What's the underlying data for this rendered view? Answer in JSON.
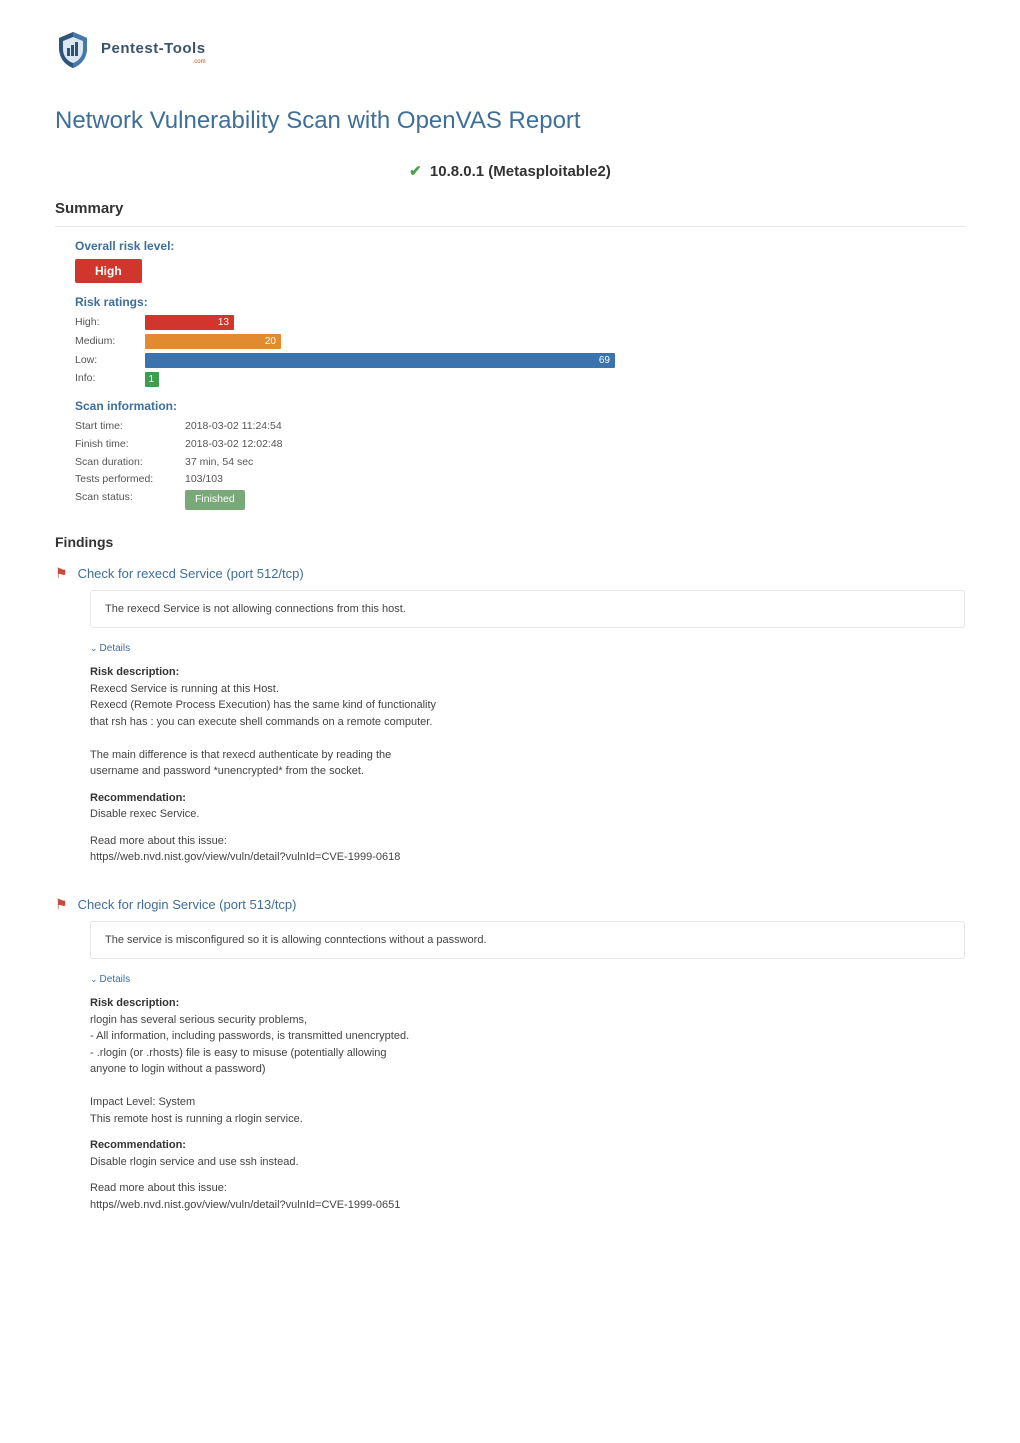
{
  "header": {
    "logo_text": "Pentest-Tools",
    "logo_sub": ".com"
  },
  "page_title": "Network Vulnerability Scan with OpenVAS Report",
  "target": {
    "ip": "10.8.0.1",
    "name": "(Metasploitable2)"
  },
  "summary": {
    "heading": "Summary",
    "overall_label": "Overall risk level:",
    "overall_value": "High",
    "ratings_label": "Risk ratings:",
    "ratings": [
      {
        "label": "High:",
        "value": 13,
        "color": "#d0362c",
        "max": 69
      },
      {
        "label": "Medium:",
        "value": 20,
        "color": "#e28a2f",
        "max": 69
      },
      {
        "label": "Low:",
        "value": 69,
        "color": "#3b73af",
        "max": 69
      },
      {
        "label": "Info:",
        "value": 1,
        "color": "#3f9e4c",
        "max": 69
      }
    ],
    "scan_info_label": "Scan information:",
    "scan_info": {
      "start_time_label": "Start time:",
      "start_time": "2018-03-02 11:24:54",
      "finish_time_label": "Finish time:",
      "finish_time": "2018-03-02 12:02:48",
      "duration_label": "Scan duration:",
      "duration": "37 min, 54 sec",
      "tests_label": "Tests performed:",
      "tests": "103/103",
      "status_label": "Scan status:",
      "status_value": "Finished"
    }
  },
  "findings_heading": "Findings",
  "findings": [
    {
      "title": "Check for rexecd Service (port 512/tcp)",
      "summary": "The rexecd Service is not allowing connections from this host.",
      "details_toggle": "Details",
      "risk_desc_label": "Risk description:",
      "risk_desc": "Rexecd Service is running at this Host.\nRexecd (Remote Process Execution) has the same kind of functionality\nthat rsh has : you can execute shell commands on a remote computer.\n\nThe main difference is that rexecd authenticate by reading the\nusername and password *unencrypted* from the socket.",
      "reco_label": "Recommendation:",
      "reco": "Disable rexec Service.",
      "read_more_label": "Read more about this issue:",
      "read_more": "https//web.nvd.nist.gov/view/vuln/detail?vulnId=CVE-1999-0618"
    },
    {
      "title": "Check for rlogin Service (port 513/tcp)",
      "summary": "The service is misconfigured so it is allowing conntections without a password.",
      "details_toggle": "Details",
      "risk_desc_label": "Risk description:",
      "risk_desc": "rlogin has several serious security problems,\n- All information, including passwords, is transmitted unencrypted.\n- .rlogin (or .rhosts) file is easy to misuse (potentially allowing\nanyone to login without a password)\n\nImpact Level: System\nThis remote host is running a rlogin service.",
      "reco_label": "Recommendation:",
      "reco": "Disable rlogin service and use ssh instead.",
      "read_more_label": "Read more about this issue:",
      "read_more": "https//web.nvd.nist.gov/view/vuln/detail?vulnId=CVE-1999-0651"
    }
  ]
}
